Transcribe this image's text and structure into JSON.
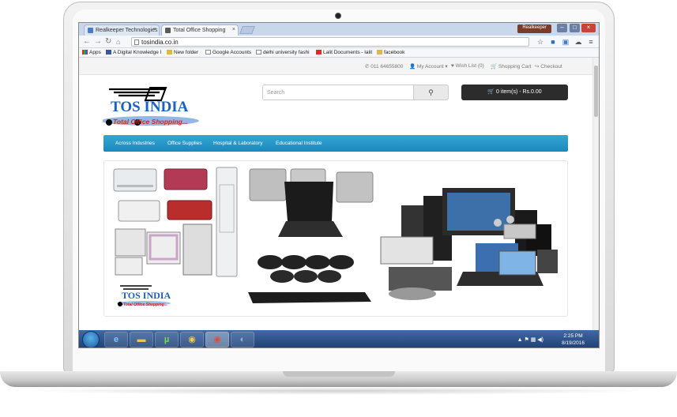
{
  "browser": {
    "tabs": [
      {
        "label": "Realkeeper Technologies"
      },
      {
        "label": "Total Office Shopping"
      }
    ],
    "profile_name": "Realkeeper",
    "address": "tosindia.co.in",
    "bookmarks": [
      {
        "label": "Apps"
      },
      {
        "label": "A Digital Knowledge I"
      },
      {
        "label": "New folder"
      },
      {
        "label": "Google Accounts"
      },
      {
        "label": "delhi university fashi"
      },
      {
        "label": "Lalit Documents - lalit"
      },
      {
        "label": "facebook"
      }
    ]
  },
  "site": {
    "topnav": {
      "phone": "011 64655800",
      "account": "My Account",
      "wishlist": "Wish List (0)",
      "cart": "Shopping Cart",
      "checkout": "Checkout"
    },
    "logo": {
      "name": "TOS INDIA",
      "tagline": "Total Office Shopping...",
      "colors": {
        "red": "#d9231d",
        "blue": "#1f5fbf",
        "black": "#000000"
      }
    },
    "search": {
      "placeholder": "Search"
    },
    "cart_button": "0 item(s) - Rs.0.00",
    "categories": [
      {
        "label": "Across Industries"
      },
      {
        "label": "Office Supplies"
      },
      {
        "label": "Hospital & Laboratory"
      },
      {
        "label": "Educational Institute"
      }
    ],
    "banner": {
      "logo_text": "TOS INDIA",
      "logo_tagline": "Total Office Shopping...",
      "slides": 5,
      "active_slide": 3
    },
    "accent_color": "#1f8fc6"
  },
  "taskbar": {
    "time": "2:25 PM",
    "date": "8/19/2016"
  }
}
